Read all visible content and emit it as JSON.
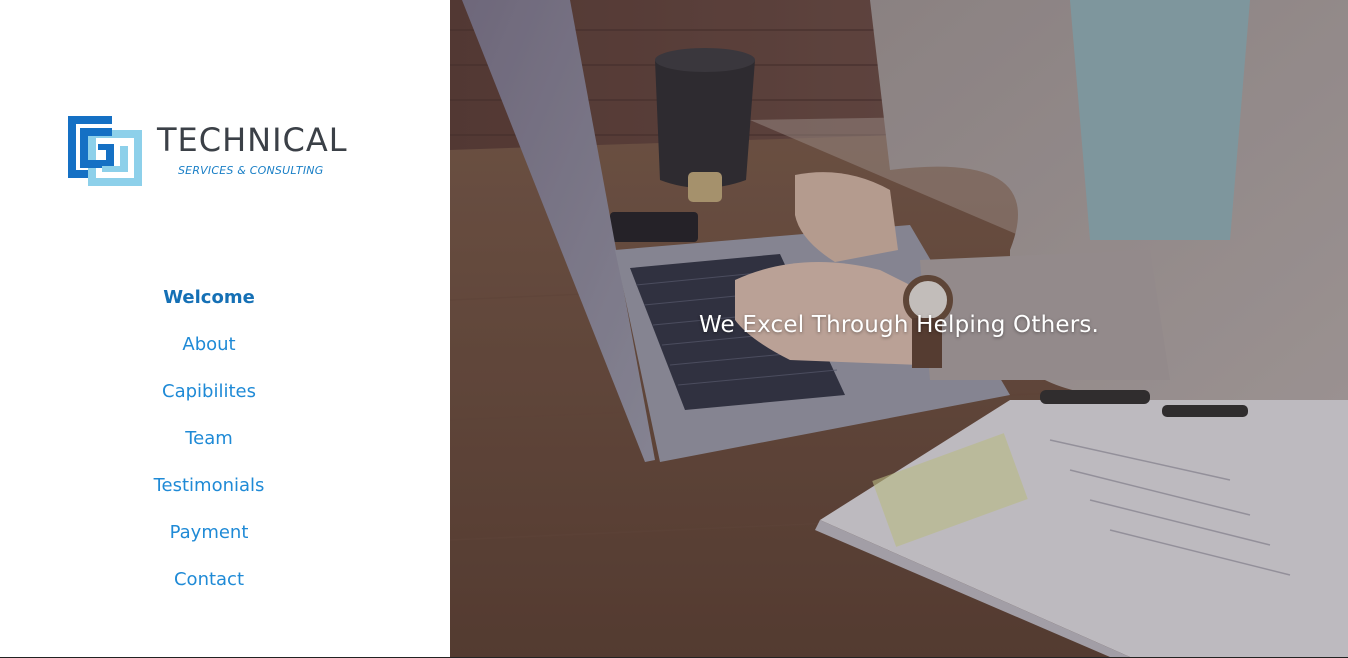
{
  "brand": {
    "name": "TECHNICAL",
    "tagline": "SERVICES & CONSULTING",
    "logo_icon": "interlocking-squares-logo",
    "colors": {
      "dark_blue": "#1570c4",
      "light_blue": "#8dd0ea",
      "text_gray": "#3b4047"
    }
  },
  "nav": {
    "items": [
      {
        "label": "Welcome",
        "active": true
      },
      {
        "label": "About",
        "active": false
      },
      {
        "label": "Capibilites",
        "active": false
      },
      {
        "label": "Team",
        "active": false
      },
      {
        "label": "Testimonials",
        "active": false
      },
      {
        "label": "Payment",
        "active": false
      },
      {
        "label": "Contact",
        "active": false
      }
    ],
    "colors": {
      "link": "#1f8ad6",
      "active": "#1570b5"
    }
  },
  "hero": {
    "tagline": "We Excel Through Helping Others.",
    "background": "person-typing-on-laptop-photo"
  }
}
